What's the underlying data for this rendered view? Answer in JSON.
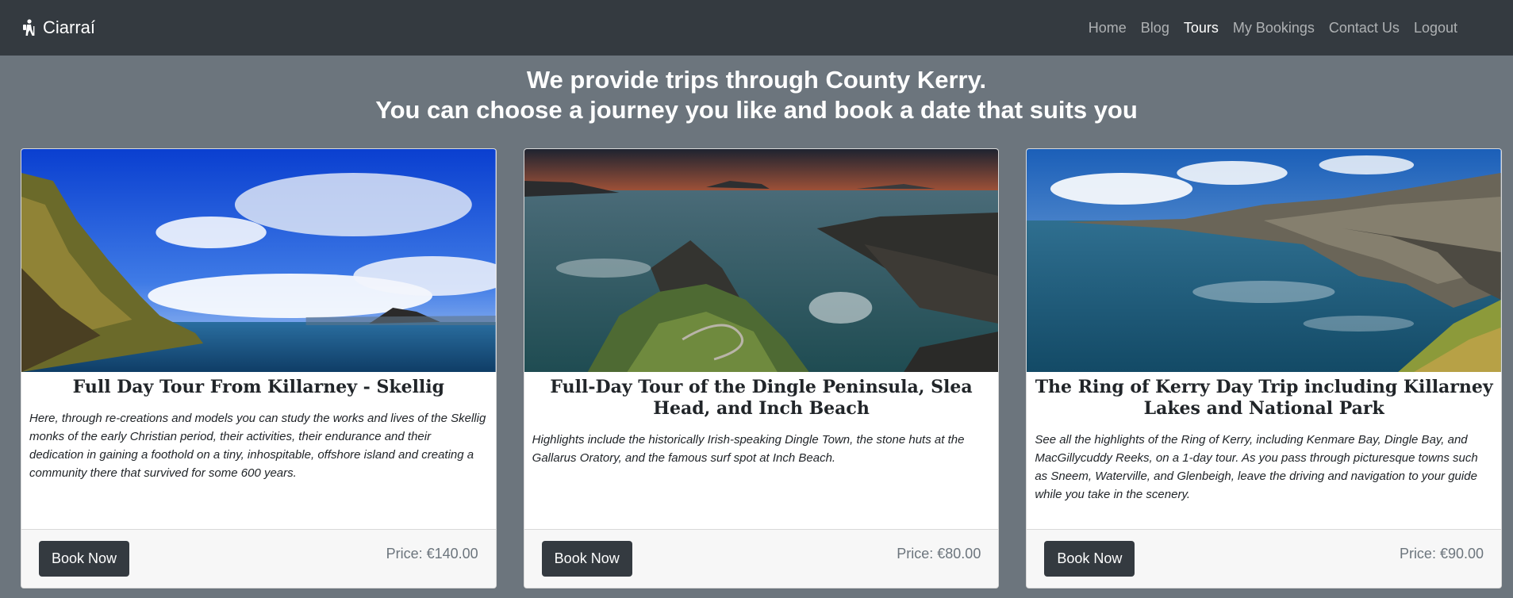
{
  "nav": {
    "brand": "Ciarraí",
    "links": [
      "Home",
      "Blog",
      "Tours",
      "My Bookings",
      "Contact Us",
      "Logout"
    ],
    "active": "Tours"
  },
  "hero": {
    "line1": "We provide trips through County Kerry.",
    "line2": "You can choose a journey you like and book a date that suits you"
  },
  "tours": [
    {
      "title": "Full Day Tour From Killarney - Skellig",
      "description": "Here, through re-creations and models you can study the works and lives of the Skellig monks of the early Christian period, their activities, their endurance and their dedication in gaining a foothold on a tiny, inhospitable, offshore island and creating a community there that survived for some 600 years.",
      "button": "Book Now",
      "price": "Price: €140.00"
    },
    {
      "title": "Full-Day Tour of the Dingle Peninsula, Slea Head, and Inch Beach",
      "description": "Highlights include the historically Irish-speaking Dingle Town, the stone huts at the Gallarus Oratory, and the famous surf spot at Inch Beach.",
      "button": "Book Now",
      "price": "Price: €80.00"
    },
    {
      "title": "The Ring of Kerry Day Trip including Killarney Lakes and National Park",
      "description": "See all the highlights of the Ring of Kerry, including Kenmare Bay, Dingle Bay, and MacGillycuddy Reeks, on a 1-day tour. As you pass through picturesque towns such as Sneem, Waterville, and Glenbeigh, leave the driving and navigation to your guide while you take in the scenery.",
      "button": "Book Now",
      "price": "Price: €90.00"
    }
  ],
  "colors": {
    "navbar": "#343a40",
    "page_bg": "#6c757d",
    "button": "#343a40"
  },
  "icons": {
    "brand": "hiking-icon"
  }
}
